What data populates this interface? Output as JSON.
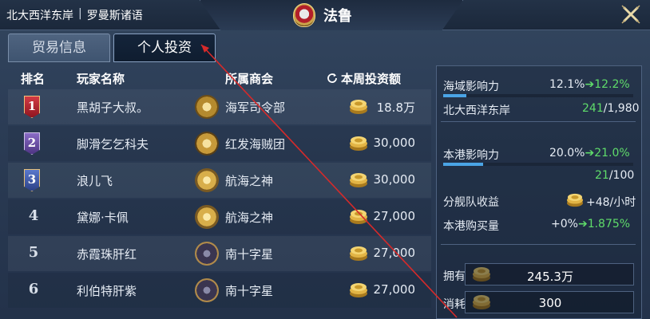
{
  "header": {
    "region": "北大西洋东岸",
    "separator": "|",
    "language": "罗曼斯诸语",
    "port_name": "法鲁"
  },
  "tabs": [
    {
      "label": "贸易信息",
      "active": false
    },
    {
      "label": "个人投资",
      "active": true
    }
  ],
  "table": {
    "headers": {
      "rank": "排名",
      "player": "玩家名称",
      "guild": "所属商会",
      "weekly": "本周投资额"
    },
    "rows": [
      {
        "rank": "1",
        "player": "黑胡子大叔。",
        "guild": "海军司令部",
        "amount": "18.8万"
      },
      {
        "rank": "2",
        "player": "脚滑乞乞科夫",
        "guild": "红发海贼团",
        "amount": "30,000"
      },
      {
        "rank": "3",
        "player": "浪儿飞",
        "guild": "航海之神",
        "amount": "30,000"
      },
      {
        "rank": "4",
        "player": "黛娜·卡佩",
        "guild": "航海之神",
        "amount": "27,000"
      },
      {
        "rank": "5",
        "player": "赤霞珠肝红",
        "guild": "南十字星",
        "amount": "27,000"
      },
      {
        "rank": "6",
        "player": "利伯特肝紫",
        "guild": "南十字星",
        "amount": "27,000"
      }
    ]
  },
  "stats": {
    "sea_influence": {
      "label": "海域影响力",
      "current": "12.1%",
      "next": "12.2%",
      "progress": 0.121
    },
    "sea_region": {
      "label": "北大西洋东岸",
      "value": "241",
      "total": "/1,980"
    },
    "port_influence": {
      "label": "本港影响力",
      "current": "20.0%",
      "next": "21.0%",
      "progress": 0.21
    },
    "port_count": {
      "value": "21",
      "total": "/100"
    },
    "fleet_income": {
      "label": "分舰队收益",
      "value": "+48/小时"
    },
    "port_purchase": {
      "label": "本港购买量",
      "current": "+0%",
      "next": "1.875%"
    }
  },
  "resources": {
    "owned": {
      "label": "拥有",
      "value": "245.3万"
    },
    "cost": {
      "label": "消耗",
      "value": "300"
    }
  },
  "colors": {
    "accent_green": "#5fdc6a",
    "progress_blue": "#4aa4e6",
    "rank1": "#b8242f",
    "rank2": "#6a4fa8",
    "rank3": "#3f5aa8"
  }
}
